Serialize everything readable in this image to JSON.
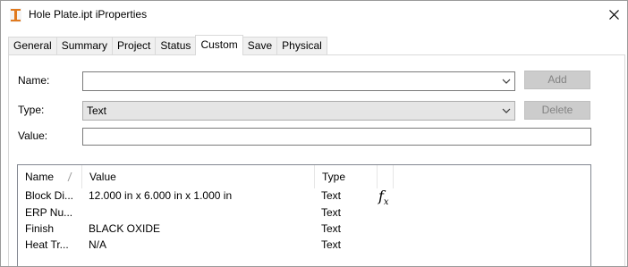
{
  "window": {
    "title": "Hole Plate.ipt iProperties",
    "close_glyph": "✕"
  },
  "tabs": [
    "General",
    "Summary",
    "Project",
    "Status",
    "Custom",
    "Save",
    "Physical"
  ],
  "active_tab": "Custom",
  "form": {
    "name_label": "Name:",
    "name_value": "",
    "type_label": "Type:",
    "type_value": "Text",
    "value_label": "Value:",
    "value_value": "",
    "add_label": "Add",
    "delete_label": "Delete"
  },
  "list": {
    "columns": [
      "Name",
      "Value",
      "Type"
    ],
    "rows": [
      {
        "name": "Block Di...",
        "value": "12.000 in x 6.000 in x 1.000 in",
        "type": "Text",
        "formula": true
      },
      {
        "name": "ERP Nu...",
        "value": "",
        "type": "Text",
        "formula": false
      },
      {
        "name": "Finish",
        "value": "BLACK OXIDE",
        "type": "Text",
        "formula": false
      },
      {
        "name": "Heat Tr...",
        "value": "N/A",
        "type": "Text",
        "formula": false
      }
    ],
    "formula_glyph": "f",
    "formula_sub": "x"
  },
  "colors": {
    "disabled_button_bg": "#cccccc",
    "disabled_text": "#838383",
    "combo_disabled_bg": "#e5e5e5",
    "border": "#7a7a7a"
  }
}
